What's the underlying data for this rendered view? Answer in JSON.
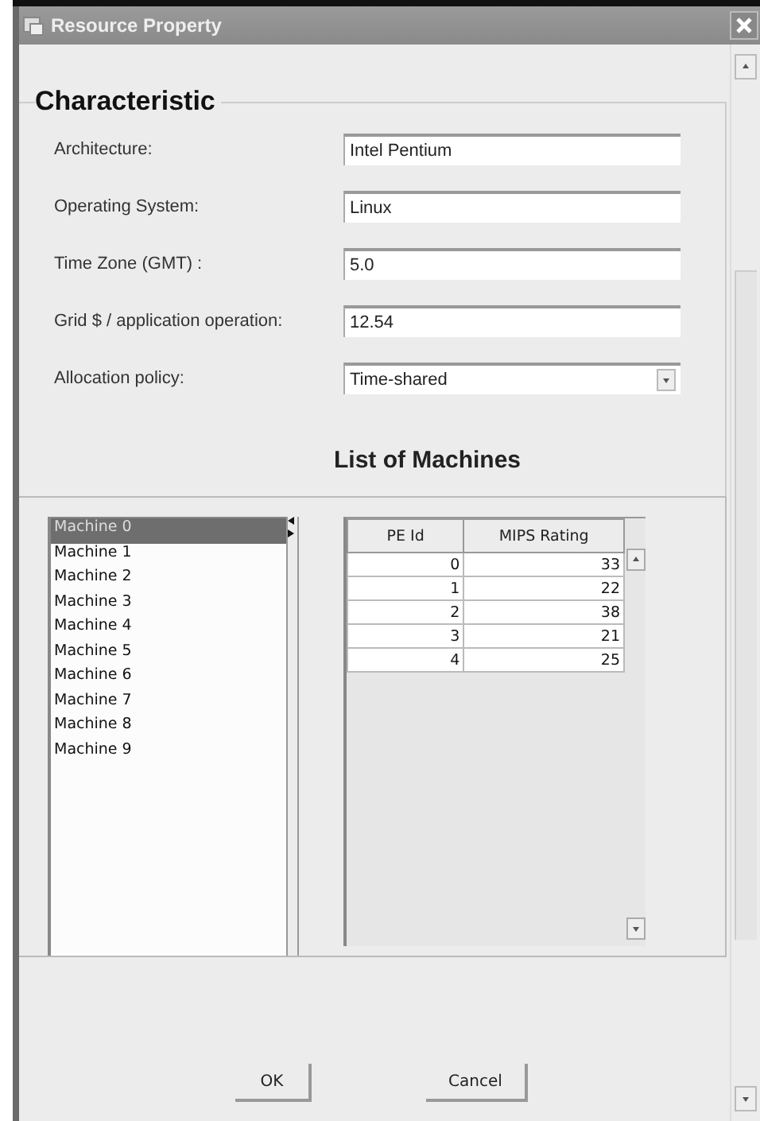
{
  "window": {
    "title": "Resource Property"
  },
  "section_title": "Characteristic",
  "fields": [
    {
      "label": "Architecture:",
      "value": "Intel Pentium",
      "kind": "text"
    },
    {
      "label": "Operating System:",
      "value": "Linux",
      "kind": "text"
    },
    {
      "label": "Time Zone (GMT) :",
      "value": "5.0",
      "kind": "text"
    },
    {
      "label": "Grid $ / application operation:",
      "value": "12.54",
      "kind": "text"
    },
    {
      "label": "Allocation policy:",
      "value": "Time-shared",
      "kind": "dropdown"
    }
  ],
  "list_title": "List of Machines",
  "machines": [
    {
      "label": "Machine 0",
      "selected": true
    },
    {
      "label": "Machine 1",
      "selected": false
    },
    {
      "label": "Machine 2",
      "selected": false
    },
    {
      "label": "Machine 3",
      "selected": false
    },
    {
      "label": "Machine 4",
      "selected": false
    },
    {
      "label": "Machine 5",
      "selected": false
    },
    {
      "label": "Machine 6",
      "selected": false
    },
    {
      "label": "Machine 7",
      "selected": false
    },
    {
      "label": "Machine 8",
      "selected": false
    },
    {
      "label": "Machine 9",
      "selected": false
    }
  ],
  "table": {
    "columns": [
      "PE Id",
      "MIPS Rating"
    ],
    "rows": [
      [
        "0",
        "33"
      ],
      [
        "1",
        "22"
      ],
      [
        "2",
        "38"
      ],
      [
        "3",
        "21"
      ],
      [
        "4",
        "25"
      ]
    ]
  },
  "buttons": [
    "OK",
    "Cancel"
  ]
}
